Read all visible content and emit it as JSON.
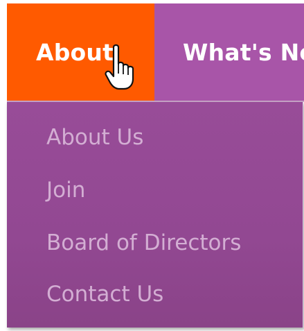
{
  "nav": {
    "items": [
      {
        "label": "About"
      },
      {
        "label": "What's Ne"
      }
    ]
  },
  "dropdown": {
    "items": [
      {
        "label": "About Us"
      },
      {
        "label": "Join"
      },
      {
        "label": "Board of Directors"
      },
      {
        "label": "Contact Us"
      }
    ]
  },
  "colors": {
    "nav_bg": "#a855a8",
    "nav_active_bg": "#ff5a00",
    "dropdown_bg": "#964a96",
    "dropdown_text": "#d3aed3",
    "nav_text": "#ffffff"
  },
  "cursor": {
    "icon": "hand-pointer-icon"
  }
}
